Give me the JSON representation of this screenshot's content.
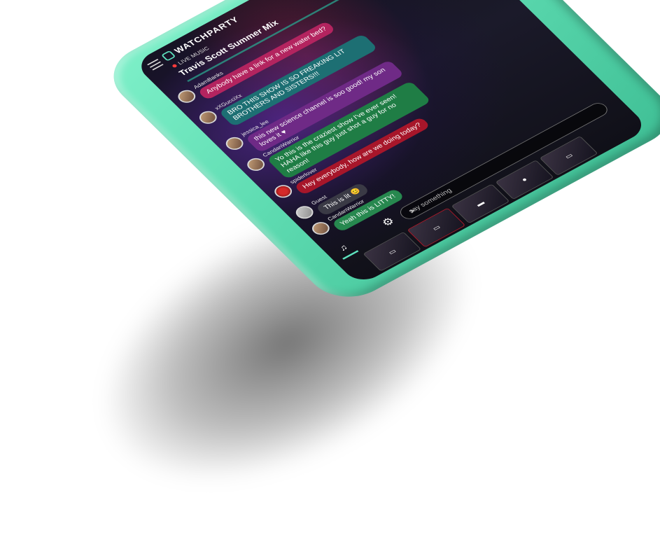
{
  "app": {
    "brand": "WATCHPARTY"
  },
  "header": {
    "category": "LIVE MUSIC",
    "title": "Travis Scott Summer Mix",
    "icons": [
      "menu-icon",
      "search-icon",
      "brand-icon"
    ]
  },
  "chat": {
    "messages": [
      {
        "user": "AdamBanks",
        "text": "Anybody have a link for a new water bed?",
        "color": "#b3245f"
      },
      {
        "user": "xXGucciXx",
        "text": "BRO THIS SHOW IS SO FREAKING LIT BROTHERS AND SISTERS!!!",
        "color": "#1d6f73"
      },
      {
        "user": "jessica_lee",
        "text": "this new science channel is soo good! my son loves it ♥",
        "color": "#6f2a86"
      },
      {
        "user": "CandanWarrior",
        "text": "Yo this is the craziest show I've ever seen! HAHA like this guy just shot a guy for no reason!",
        "color": "#1f7d45"
      },
      {
        "user": "spiderlover",
        "text": "Hey everybody, how are we doing today?",
        "color": "#a7162a"
      },
      {
        "user": "Guest",
        "text": "This is lit 😊",
        "color": "#3a3a45"
      },
      {
        "user": "CandanWarrior",
        "text": "Yeah this is LITTY!",
        "color": "#27884f"
      }
    ]
  },
  "composer": {
    "placeholder": "say something"
  },
  "tabs": {
    "music_icon": "♫",
    "settings_icon": "⚙",
    "send_icon": "➤"
  },
  "thumbnails": [
    "▭",
    "▭",
    "▬",
    "●",
    "▭"
  ]
}
